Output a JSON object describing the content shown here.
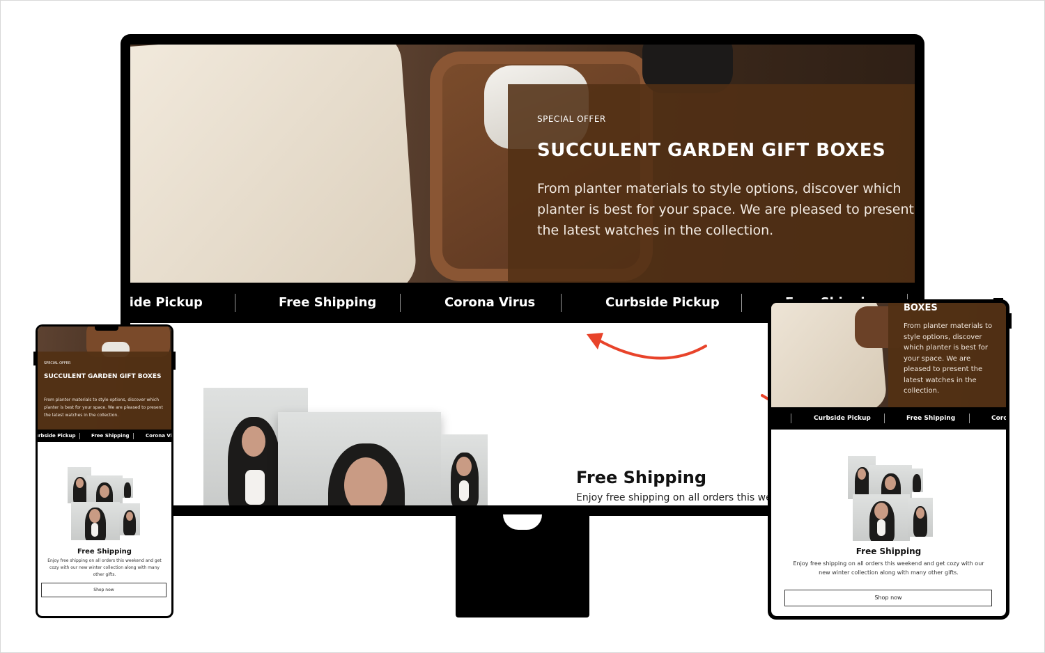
{
  "hero": {
    "eyebrow": "SPECIAL OFFER",
    "title": "SUCCULENT GARDEN GIFT BOXES",
    "text": "From planter materials to style options, discover which planter is best for your space. We are pleased to present the latest watches in the collection."
  },
  "desktop_ticker": [
    "side Pickup",
    "Free Shipping",
    "Corona Virus",
    "Curbside Pickup",
    "Free Shipping"
  ],
  "phone_ticker": [
    "urbside Pickup",
    "Free Shipping",
    "Corona Vir"
  ],
  "tablet_ticker": [
    "Curbside Pickup",
    "Free Shipping",
    "Coro"
  ],
  "tablet_hero": {
    "title": "BOXES",
    "text": "From planter materials to style options, discover which planter is best for your space. We are pleased to present the latest watches in the collection."
  },
  "feature": {
    "title": "Free Shipping",
    "text_desktop": "Enjoy free shipping on all orders this wee",
    "text": "Enjoy free shipping on all orders this weekend and get cozy with our new winter collection along with many other gifts.",
    "button": "Shop now"
  },
  "colors": {
    "accent_brown": "#523014",
    "arrow_red": "#e8432a",
    "ticker_bg": "#000000"
  },
  "icons": [
    "curved-arrow-icon"
  ]
}
